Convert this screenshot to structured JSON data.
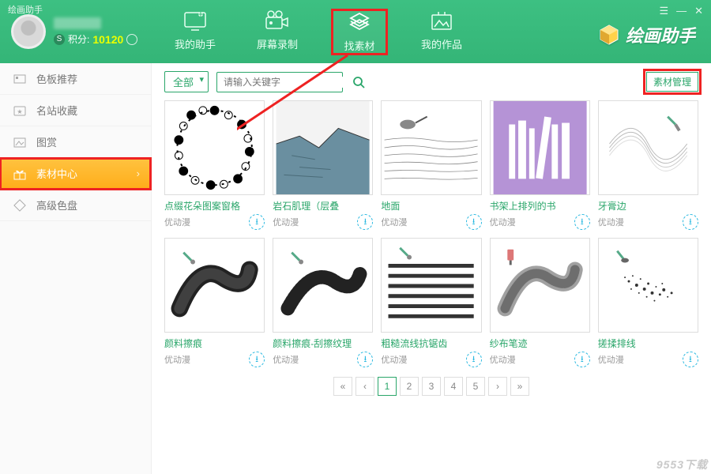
{
  "app_title": "绘画助手",
  "user": {
    "points_label": "积分:",
    "points": "10120"
  },
  "top_tabs": [
    {
      "label": "我的助手"
    },
    {
      "label": "屏幕录制"
    },
    {
      "label": "找素材"
    },
    {
      "label": "我的作品"
    }
  ],
  "brand": "绘画助手",
  "sidebar": {
    "items": [
      {
        "label": "色板推荐"
      },
      {
        "label": "名站收藏"
      },
      {
        "label": "图赏"
      },
      {
        "label": "素材中心"
      },
      {
        "label": "高级色盘"
      }
    ]
  },
  "toolbar": {
    "filter_label": "全部",
    "search_placeholder": "请输入关键字",
    "manage_label": "素材管理"
  },
  "cards": [
    {
      "title": "点缀花朵图案窗格",
      "author": "优动漫"
    },
    {
      "title": "岩石肌理（层叠",
      "author": "优动漫"
    },
    {
      "title": "地面",
      "author": "优动漫"
    },
    {
      "title": "书架上排列的书",
      "author": "优动漫"
    },
    {
      "title": "牙膏边",
      "author": "优动漫"
    },
    {
      "title": "颜料擦痕",
      "author": "优动漫"
    },
    {
      "title": "颜料擦痕-刮擦纹理",
      "author": "优动漫"
    },
    {
      "title": "粗糙流线抗锯齿",
      "author": "优动漫"
    },
    {
      "title": "纱布笔迹",
      "author": "优动漫"
    },
    {
      "title": "搓揉排线",
      "author": "优动漫"
    }
  ],
  "pager": {
    "pages": [
      "1",
      "2",
      "3",
      "4",
      "5"
    ]
  },
  "watermark": "9553下载"
}
